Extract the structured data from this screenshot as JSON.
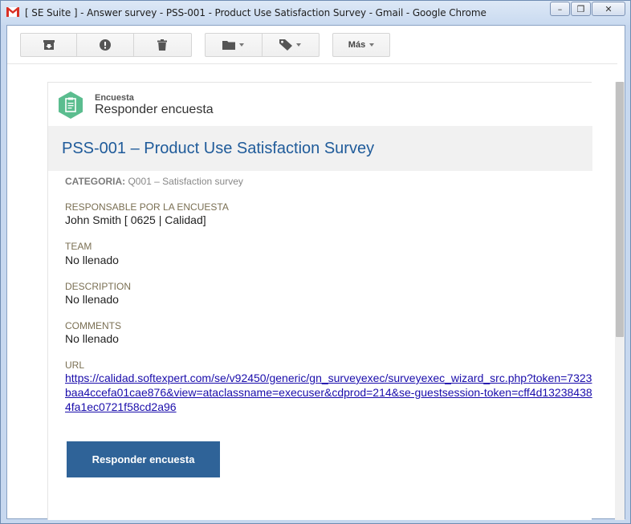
{
  "window": {
    "title": "[ SE Suite ] - Answer survey - PSS-001 - Product Use Satisfaction Survey - Gmail - Google Chrome",
    "minimize_glyph": "–",
    "restore_glyph": "❐",
    "close_glyph": "✕"
  },
  "toolbar": {
    "more_label": "Más"
  },
  "colors": {
    "accent": "#2f6398",
    "title_blue": "#1f5b9a",
    "hex_green": "#5bbd8f",
    "label_olive": "#7a6f53",
    "link": "#1a0dab"
  },
  "card": {
    "kicker": "Encuesta",
    "heading": "Responder encuesta",
    "survey_title": "PSS-001 – Product Use Satisfaction Survey",
    "category_key": "CATEGORIA:",
    "category_value": "Q001 – Satisfaction survey",
    "fields": [
      {
        "label": "RESPONSABLE POR LA ENCUESTA",
        "value": "John Smith [ 0625 | Calidad]"
      },
      {
        "label": "TEAM",
        "value": "No llenado"
      },
      {
        "label": "DESCRIPTION",
        "value": "No llenado"
      },
      {
        "label": "COMMENTS",
        "value": "No llenado"
      }
    ],
    "url_label": "URL",
    "url": "https://calidad.softexpert.com/se/v92450/generic/gn_surveyexec/surveyexec_wizard_src.php?token=7323baa4ccefa01cae876&view=ataclassname=execuser&cdprod=214&se-guestsession-token=cff4d132384384fa1ec0721f58cd2a96",
    "cta_label": "Responder encuesta"
  }
}
